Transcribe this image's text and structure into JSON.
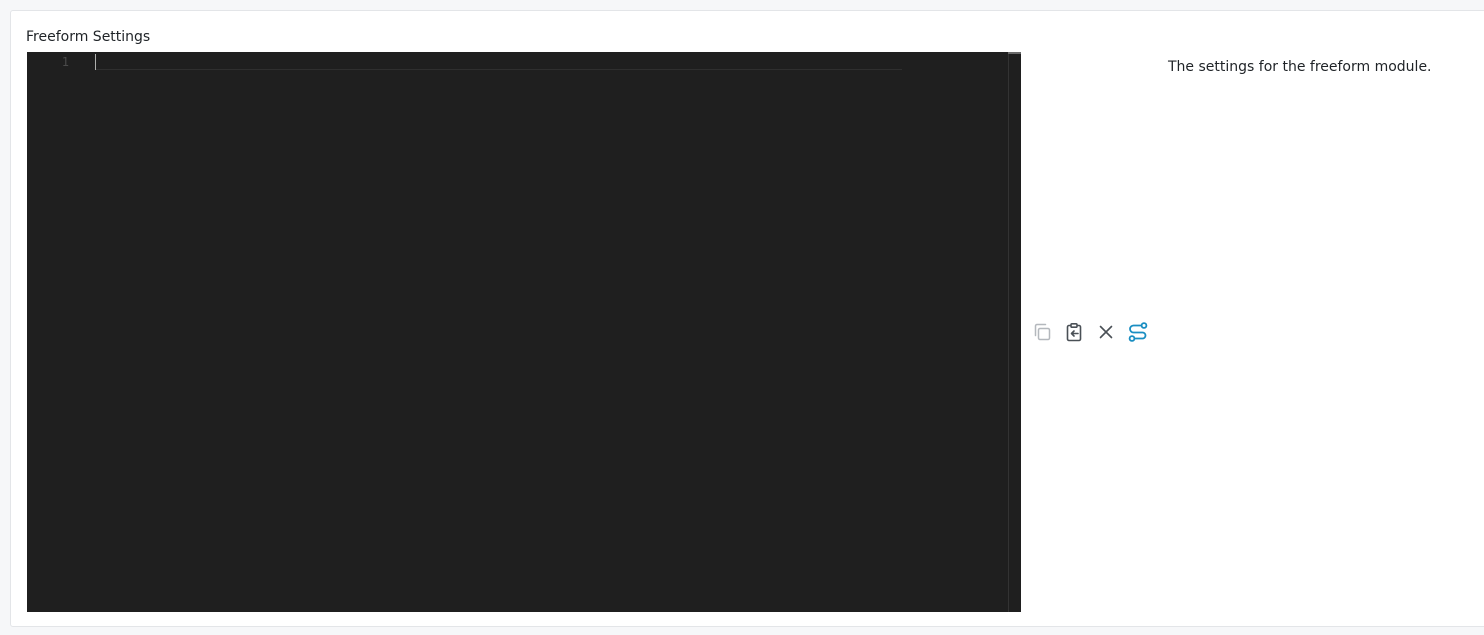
{
  "field": {
    "title": "Freeform Settings",
    "description": "The settings for the freeform module."
  },
  "editor": {
    "line_numbers": [
      "1"
    ],
    "content": ""
  },
  "toolbar": {
    "buttons": [
      {
        "name": "copy",
        "icon": "copy-icon",
        "state": "disabled"
      },
      {
        "name": "paste",
        "icon": "clipboard-paste-icon",
        "state": "enabled"
      },
      {
        "name": "clear",
        "icon": "close-icon",
        "state": "enabled"
      },
      {
        "name": "settings",
        "icon": "route-settings-icon",
        "state": "active"
      }
    ]
  },
  "colors": {
    "editor_background": "#1f1f1f",
    "accent": "#1a8ec2",
    "icon_default": "#4a5056",
    "icon_disabled": "#b4b8bd"
  }
}
